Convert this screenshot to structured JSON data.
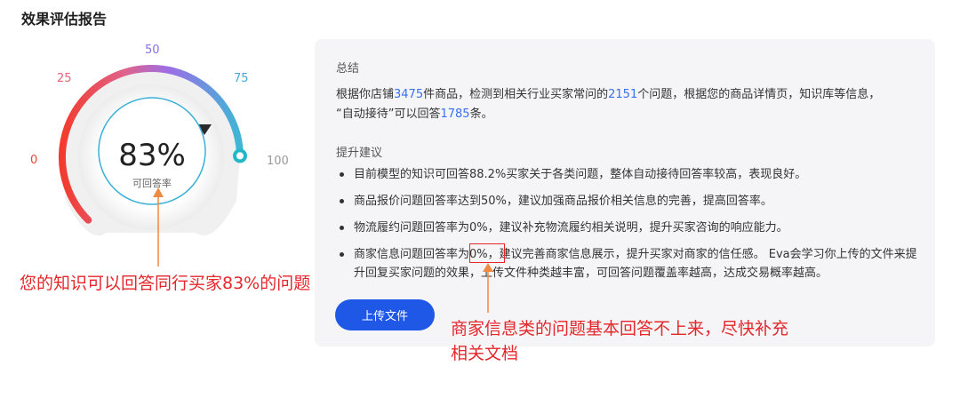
{
  "title": "效果评估报告",
  "gauge": {
    "value_text": "83%",
    "value": 83,
    "label": "可回答率",
    "ticks": [
      "0",
      "25",
      "50",
      "75",
      "100"
    ],
    "tick_colors": [
      "#e8472f",
      "#e6627a",
      "#8a6ee8",
      "#4aa4d8",
      "#999999"
    ]
  },
  "annotation_left": "您的知识可以回答同行买家83%的问题",
  "card": {
    "summary_heading": "总结",
    "summary": {
      "p1": "根据你店铺",
      "n1": "3475",
      "p2": "件商品，检测到相关行业买家常问的",
      "n2": "2151",
      "p3": "个问题，根据您的商品详情页，知识库等信息，",
      "p4": "“自动接待”可以回答",
      "n3": "1785",
      "p5": "条。"
    },
    "advice_heading": "提升建议",
    "advice": [
      "目前模型的知识可回答88.2%买家关于各类问题，整体自动接待回答率较高，表现良好。",
      "商品报价问题回答率达到50%，建议加强商品报价相关信息的完善，提高回答率。",
      "物流履约问题回答率为0%，建议补充物流履约相关说明，提升买家咨询的响应能力。",
      "商家信息问题回答率为0%，建议完善商家信息展示，提升买家对商家的信任感。 Eva会学习你上传的文件来提升回复买家问题的效果，上传文件种类越丰富，可回答问题覆盖率越高，达成交易概率越高。"
    ],
    "upload_label": "上传文件"
  },
  "annotation_right": "商家信息类的问题基本回答不上来，尽快补充相关文档",
  "colors": {
    "accent": "#1f57e7",
    "highlight": "#3a6ff0",
    "annotation": "#e5262a"
  }
}
